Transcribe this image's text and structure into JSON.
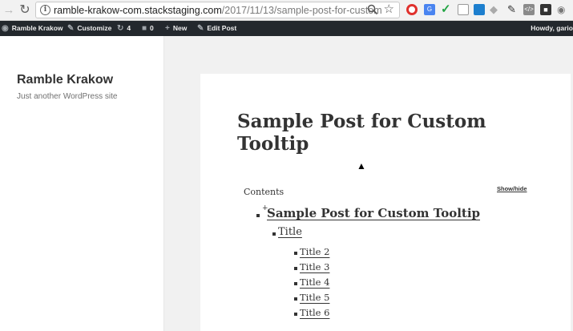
{
  "browser": {
    "url_host": "ramble-krakow-com.stackstaging.com",
    "url_path": "/2017/11/13/sample-post-for-custom-to..."
  },
  "adminbar": {
    "site": "Ramble Krakow",
    "customize": "Customize",
    "updates_count": "4",
    "comments_count": "0",
    "new": "New",
    "edit_post": "Edit Post",
    "howdy": "Howdy, gario"
  },
  "site": {
    "title": "Ramble Krakow",
    "description": "Just another WordPress site"
  },
  "post": {
    "title": "Sample Post for Custom Tooltip"
  },
  "toc": {
    "label": "Contents",
    "toggle": "Show/hide",
    "level1": {
      "plus": "+",
      "label": "Sample Post for Custom Tooltip"
    },
    "level2": {
      "label": "Title"
    },
    "level3": [
      {
        "label": "Title 2"
      },
      {
        "label": "Title 3"
      },
      {
        "label": "Title 4"
      },
      {
        "label": "Title 5"
      },
      {
        "label": "Title 6"
      }
    ]
  }
}
